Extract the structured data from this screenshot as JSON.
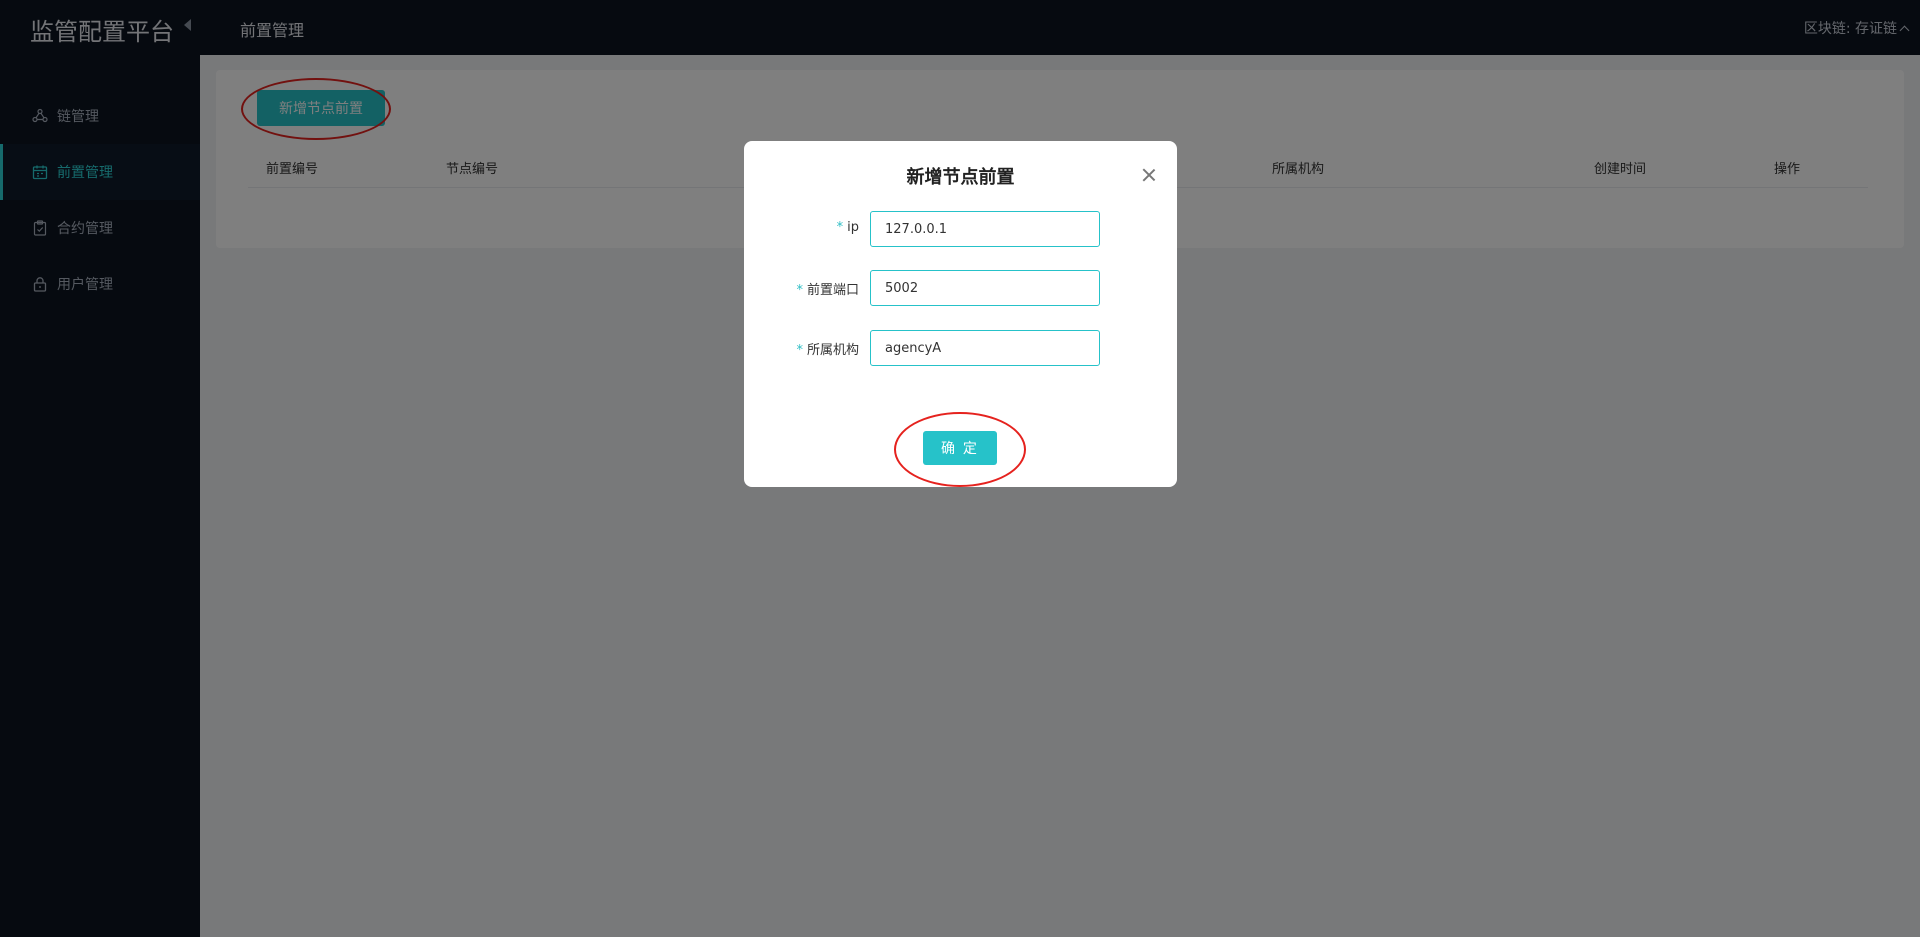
{
  "app": {
    "title": "监管配置平台"
  },
  "sidebar": {
    "items": [
      {
        "label": "链管理",
        "icon": "chain-network-icon",
        "active": false
      },
      {
        "label": "前置管理",
        "icon": "calendar-icon",
        "active": true
      },
      {
        "label": "合约管理",
        "icon": "clipboard-icon",
        "active": false
      },
      {
        "label": "用户管理",
        "icon": "lock-icon",
        "active": false
      }
    ]
  },
  "topbar": {
    "page_title": "前置管理",
    "chain_selector": "区块链: 存证链"
  },
  "main": {
    "add_button_label": "新增节点前置",
    "table_headers": [
      "前置编号",
      "节点编号",
      "所属机构",
      "创建时间",
      "操作"
    ]
  },
  "modal": {
    "title": "新增节点前置",
    "fields": [
      {
        "label": "ip",
        "value": "127.0.0.1",
        "required_mark": "*"
      },
      {
        "label": "前置端口",
        "value": "5002",
        "required_mark": "*"
      },
      {
        "label": "所属机构",
        "value": "agencyA",
        "required_mark": "*"
      }
    ],
    "confirm_label": "确 定"
  },
  "colors": {
    "accent": "#26c2c9",
    "sidebar_bg": "#0c1421",
    "annotation_ring": "#e5221e"
  }
}
